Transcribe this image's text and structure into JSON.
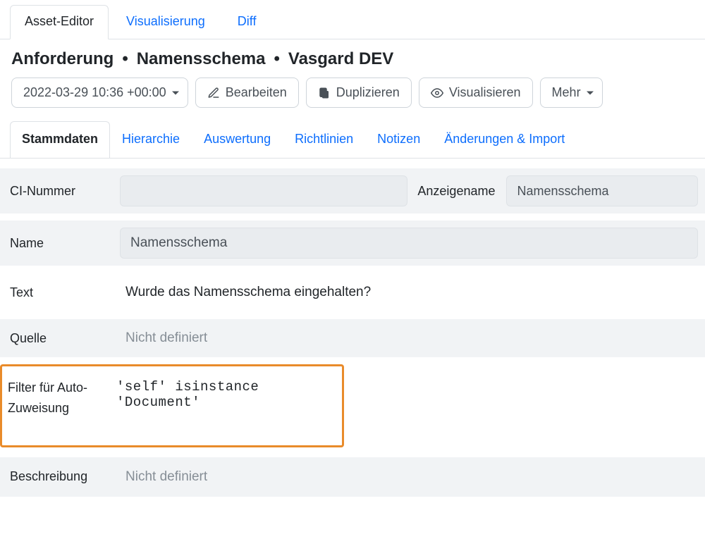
{
  "top_tabs": {
    "asset_editor": "Asset-Editor",
    "visualisierung": "Visualisierung",
    "diff": "Diff"
  },
  "breadcrumb": {
    "item1": "Anforderung",
    "item2": "Namensschema",
    "item3": "Vasgard DEV"
  },
  "toolbar": {
    "date_label": "2022-03-29 10:36 +00:00",
    "edit_label": "Bearbeiten",
    "duplicate_label": "Duplizieren",
    "visualize_label": "Visualisieren",
    "more_label": "Mehr"
  },
  "inner_tabs": {
    "stammdaten": "Stammdaten",
    "hierarchie": "Hierarchie",
    "auswertung": "Auswertung",
    "richtlinien": "Richtlinien",
    "notizen": "Notizen",
    "aenderungen": "Änderungen & Import"
  },
  "form": {
    "ci_number_label": "CI-Nummer",
    "ci_number_value": "",
    "anzeigename_label": "Anzeigename",
    "anzeigename_value": "Namensschema",
    "name_label": "Name",
    "name_value": "Namensschema",
    "text_label": "Text",
    "text_value": "Wurde das Namensschema eingehalten?",
    "quelle_label": "Quelle",
    "quelle_value": "Nicht definiert",
    "filter_label": "Filter für Auto-Zuweisung",
    "filter_value": "'self' isinstance 'Document'",
    "beschreibung_label": "Beschreibung",
    "beschreibung_value": "Nicht definiert"
  }
}
